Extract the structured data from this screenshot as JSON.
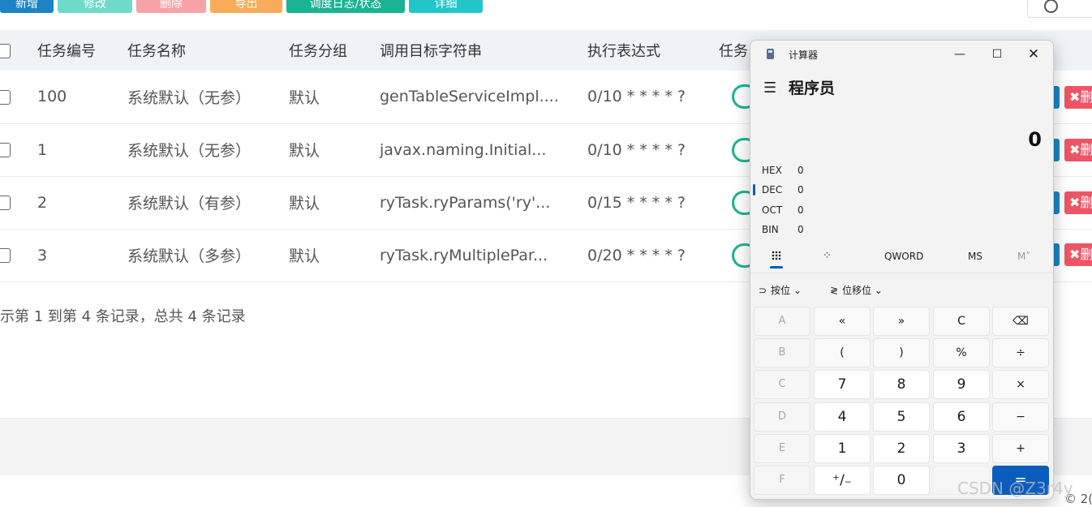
{
  "toolbar": {
    "buttons": [
      "新增",
      "修改",
      "删除",
      "导出",
      "调度日志/状态",
      "详细"
    ]
  },
  "table": {
    "headers": [
      "",
      "任务编号",
      "任务名称",
      "任务分组",
      "调用目标字符串",
      "执行表达式",
      "任务"
    ],
    "rows": [
      {
        "id": "100",
        "name": "系统默认（无参）",
        "group": "默认",
        "target": "genTableServiceImpl....",
        "cron": "0/10 * * * * ?"
      },
      {
        "id": "1",
        "name": "系统默认（无参）",
        "group": "默认",
        "target": "javax.naming.Initial...",
        "cron": "0/10 * * * * ?"
      },
      {
        "id": "2",
        "name": "系统默认（有参）",
        "group": "默认",
        "target": "ryTask.ryParams('ry'...",
        "cron": "0/15 * * * * ?"
      },
      {
        "id": "3",
        "name": "系统默认（多参）",
        "group": "默认",
        "target": "ryTask.ryMultiplePar...",
        "cron": "0/20 * * * * ?"
      }
    ],
    "delete_label": "✖删"
  },
  "pagination": {
    "info": "示第 1 到第 4 条记录，总共 4 条记录"
  },
  "footer": {
    "copyright": "© 2("
  },
  "watermark": "CSDN @Z3r4y",
  "colors": {
    "primary": "#1c84c6",
    "danger": "#ed5565",
    "calc_accent": "#0a5dbd"
  },
  "calculator": {
    "app_title": "计算器",
    "mode_title": "程序员",
    "display": "0",
    "radix": [
      {
        "name": "HEX",
        "value": "0"
      },
      {
        "name": "DEC",
        "value": "0",
        "active": true
      },
      {
        "name": "OCT",
        "value": "0"
      },
      {
        "name": "BIN",
        "value": "0"
      }
    ],
    "controls": {
      "word_size": "QWORD",
      "memory_store": "MS",
      "memory_view": "M˅"
    },
    "ops": {
      "bitwise": "按位",
      "bit_shift": "位移位"
    },
    "keys": [
      [
        "A",
        "«",
        "»",
        "C",
        "⌫"
      ],
      [
        "B",
        "(",
        ")",
        "%",
        "÷"
      ],
      [
        "C",
        "7",
        "8",
        "9",
        "×"
      ],
      [
        "D",
        "4",
        "5",
        "6",
        "−"
      ],
      [
        "E",
        "1",
        "2",
        "3",
        "+"
      ],
      [
        "F",
        "⁺∕₋",
        "0",
        "",
        "="
      ]
    ]
  }
}
